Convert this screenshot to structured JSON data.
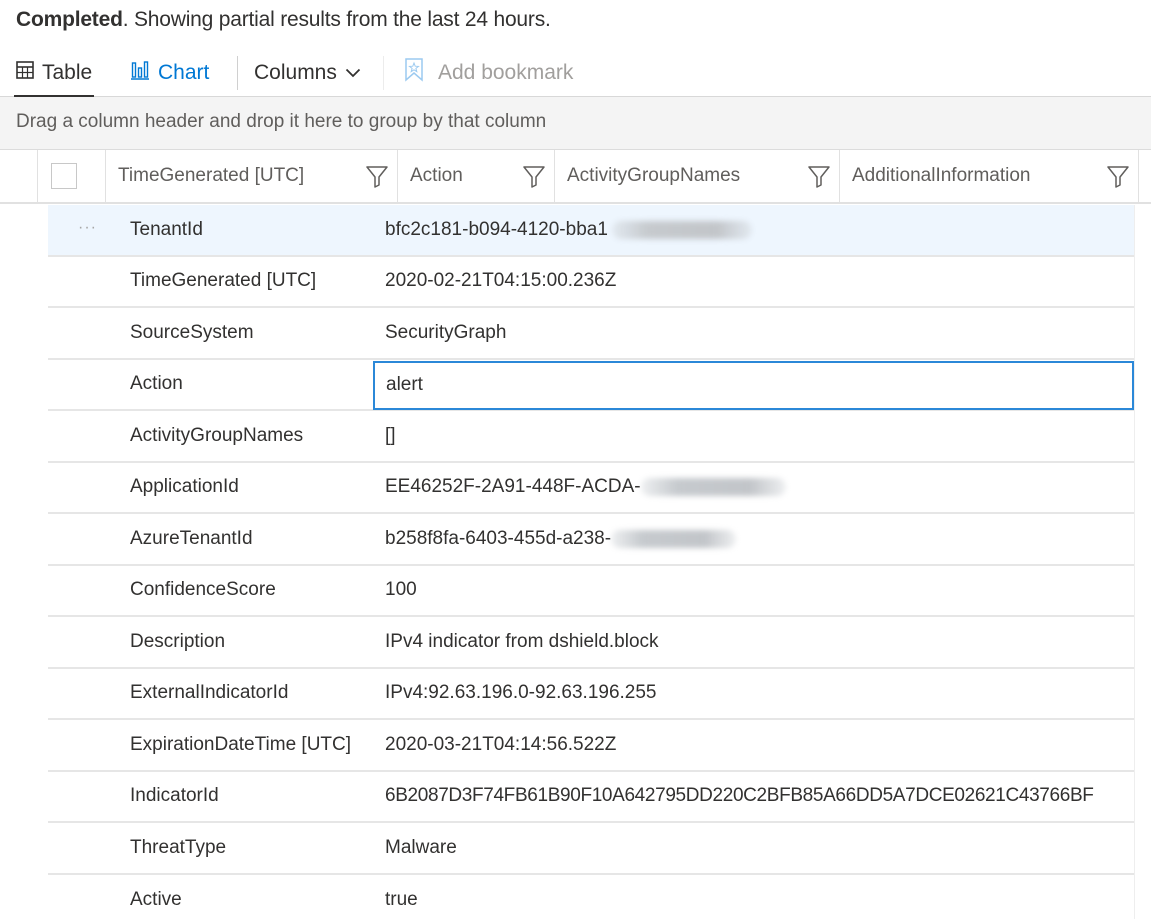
{
  "status": {
    "bold": "Completed",
    "rest": ". Showing partial results from the last 24 hours."
  },
  "toolbar": {
    "table_label": "Table",
    "chart_label": "Chart",
    "columns_label": "Columns",
    "bookmark_label": "Add bookmark",
    "active_tab": "Table",
    "accent_color": "#0078d4"
  },
  "groupbar": {
    "hint": "Drag a column header and drop it here to group by that column"
  },
  "header": {
    "columns": [
      {
        "label": "TimeGenerated [UTC]"
      },
      {
        "label": "Action"
      },
      {
        "label": "ActivityGroupNames"
      },
      {
        "label": "AdditionalInformation"
      }
    ]
  },
  "detail": {
    "rows": [
      {
        "key": "TenantId",
        "value": "bfc2c181-b094-4120-bba1",
        "redacted": true
      },
      {
        "key": "TimeGenerated [UTC]",
        "value": "2020-02-21T04:15:00.236Z"
      },
      {
        "key": "SourceSystem",
        "value": "SecurityGraph"
      },
      {
        "key": "Action",
        "value": "alert",
        "focused": true
      },
      {
        "key": "ActivityGroupNames",
        "value": "[]"
      },
      {
        "key": "ApplicationId",
        "value": "EE46252F-2A91-448F-ACDA-",
        "redacted": true
      },
      {
        "key": "AzureTenantId",
        "value": "b258f8fa-6403-455d-a238-",
        "redacted": true
      },
      {
        "key": "ConfidenceScore",
        "value": "100"
      },
      {
        "key": "Description",
        "value": "IPv4 indicator from dshield.block"
      },
      {
        "key": "ExternalIndicatorId",
        "value": "IPv4:92.63.196.0-92.63.196.255"
      },
      {
        "key": "ExpirationDateTime [UTC]",
        "value": "2020-03-21T04:14:56.522Z"
      },
      {
        "key": "IndicatorId",
        "value": "6B2087D3F74FB61B90F10A642795DD220C2BFB85A66DD5A7DCE02621C43766BF"
      },
      {
        "key": "ThreatType",
        "value": "Malware"
      },
      {
        "key": "Active",
        "value": "true"
      }
    ]
  }
}
